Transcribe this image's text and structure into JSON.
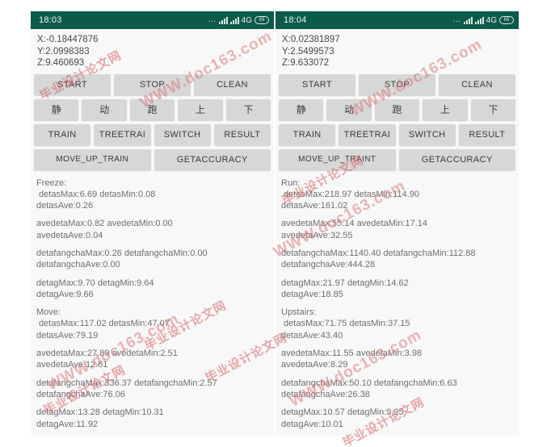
{
  "watermark": {
    "url_text": "WWW.doc163.com",
    "cn_text": "毕业设计论文网",
    "color": "#de7878"
  },
  "panels": [
    {
      "id": "left",
      "statusbar": {
        "time": "18:03",
        "dots": "...",
        "network": "4G",
        "battery": "69",
        "bg_color": "#0c5a4b"
      },
      "sensor": {
        "x": "X:-0.18447876",
        "y": "Y:2.0998383",
        "z": "Z:9.460693"
      },
      "buttons": [
        [
          "START",
          "STOP",
          "CLEAN"
        ],
        [
          "静",
          "动",
          "跑",
          "上",
          "下"
        ],
        [
          "TRAIN",
          "TREETRAI",
          "SWITCH",
          "RESULT"
        ],
        [
          "MOVE_UP_TRAIN",
          "GETACCURACY"
        ]
      ],
      "log": [
        "Freeze:",
        " detasMax:6.69 detasMin:0.08",
        "detasAve:0.26",
        "",
        "avedetaMax:0.82 avedetaMin:0.00",
        "avedetaAve:0.04",
        "",
        "detafangchaMax:0.26 detafangchaMin:0.00",
        "detafangchaAve:0.00",
        "",
        "detagMax:9.70 detagMin:9.64",
        "detagAve:9.66",
        "",
        "Move:",
        " detasMax:117.02 detasMin:47.07",
        "detasAve:79.19",
        "",
        "avedetaMax:27.89 avedetaMin:2.51",
        "avedetaAve:12.61",
        "",
        "detafangchaMax:336.37 detafangchaMin:2.57",
        "detafangchaAve:76.06",
        "",
        "detagMax:13.28 detagMin:10.31",
        "detagAve:11.92"
      ]
    },
    {
      "id": "right",
      "statusbar": {
        "time": "18:04",
        "dots": "...",
        "network": "4G",
        "battery": "69",
        "bg_color": "#0c5a4b"
      },
      "sensor": {
        "x": "X:0.02381897",
        "y": "Y:2.5499573",
        "z": "Z:9.633072"
      },
      "buttons": [
        [
          "START",
          "STOP",
          "CLEAN"
        ],
        [
          "静",
          "动",
          "跑",
          "上",
          "下"
        ],
        [
          "TRAIN",
          "TREETRAI",
          "SWITCH",
          "RESULT"
        ],
        [
          "MOVE_UP_TRAINT",
          "GETACCURACY"
        ]
      ],
      "log": [
        "Run:",
        " detasMax:218.97 detasMin:114.90",
        "detasAve:161.02",
        "",
        "avedetaMax:55.14 avedetaMin:17.14",
        "avedetaAve:32.55",
        "",
        "detafangchaMax:1140.40 detafangchaMin:112.88",
        "detafangchaAve:444.28",
        "",
        "detagMax:21.97 detagMin:14.62",
        "detagAve:18.85",
        "",
        "Upstairs:",
        " detasMax:71.75 detasMin:37.15",
        "detasAve:43.40",
        "",
        "avedetaMax:11.55 avedetaMin:3.98",
        "avedetaAve:8.29",
        "",
        "detafangchaMax:50.10 detafangchaMin:6.63",
        "detafangchaAve:26.38",
        "",
        "detagMax:10.57 detagMin:9.25",
        "detagAve:10.01"
      ]
    }
  ]
}
